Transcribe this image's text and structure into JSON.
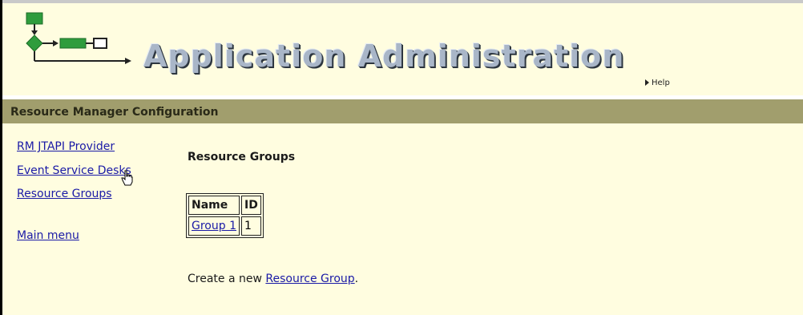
{
  "header": {
    "app_title": "Application Administration",
    "help_label": "Help"
  },
  "section": {
    "title": "Resource Manager Configuration"
  },
  "nav": {
    "items": [
      {
        "label": "RM JTAPI Provider"
      },
      {
        "label": "Event Service Desks"
      },
      {
        "label": "Resource Groups"
      },
      {
        "label": "Main menu"
      }
    ]
  },
  "content": {
    "title": "Resource Groups",
    "table": {
      "columns": [
        "Name",
        "ID"
      ],
      "rows": [
        {
          "name": "Group 1",
          "id": "1"
        }
      ]
    },
    "create_prefix": "Create a new ",
    "create_link": "Resource Group",
    "create_suffix": "."
  },
  "colors": {
    "background": "#fffde0",
    "section_bar": "#a19e6d",
    "link": "#1a1aa6",
    "logo_green": "#2f9c3d"
  },
  "icons": {
    "logo": "flowchart-logo-icon",
    "help": "triangle-right-icon",
    "cursor": "hand-pointer-icon"
  }
}
